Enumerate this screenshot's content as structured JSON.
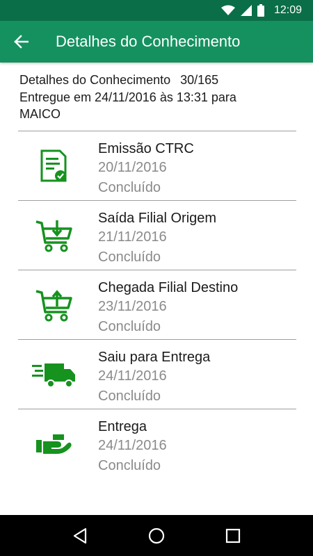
{
  "status_bar": {
    "time": "12:09"
  },
  "app_bar": {
    "title": "Detalhes do Conhecimento"
  },
  "summary": {
    "label": "Detalhes do Conhecimento",
    "number": "30/165",
    "delivered_line": "Entregue em 24/11/2016 às 13:31 para",
    "recipient": "MAICO"
  },
  "events": [
    {
      "icon": "document-check-icon",
      "title": "Emissão CTRC",
      "date": "20/11/2016",
      "status": "Concluído"
    },
    {
      "icon": "cart-down-icon",
      "title": "Saída Filial Origem",
      "date": "21/11/2016",
      "status": "Concluído"
    },
    {
      "icon": "cart-up-icon",
      "title": "Chegada Filial Destino",
      "date": "23/11/2016",
      "status": "Concluído"
    },
    {
      "icon": "delivery-truck-icon",
      "title": "Saiu para Entrega",
      "date": "24/11/2016",
      "status": "Concluído"
    },
    {
      "icon": "hand-package-icon",
      "title": "Entrega",
      "date": "24/11/2016",
      "status": "Concluído"
    }
  ],
  "colors": {
    "primary": "#15915f",
    "primary_dark": "#0a6e48",
    "icon_green": "#16921f"
  }
}
